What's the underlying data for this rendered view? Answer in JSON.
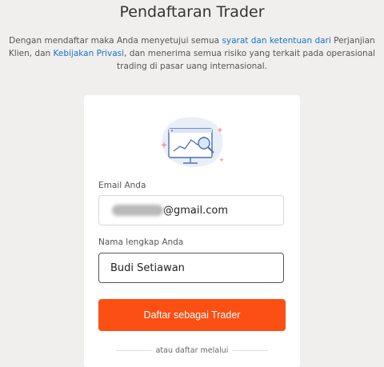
{
  "page": {
    "title": "Pendaftaran Trader",
    "intro": {
      "part1": "Dengan mendaftar maka Anda menyetujui semua ",
      "link_terms": "syarat dan ketentuan dari",
      "part2": " Perjanjian Klien, dan ",
      "link_privacy": "Kebijakan Privasi",
      "part3": ", dan menerima semua risiko yang terkait pada operasional trading di pasar uang internasional."
    }
  },
  "form": {
    "illustration_icon": "monitor-chart-magnifier-icon",
    "email_label": "Email Anda",
    "email_value_visible": "@gmail.com",
    "name_label": "Nama lengkap Anda",
    "name_value": "Budi Setiawan",
    "submit_label": "Daftar sebagai Trader",
    "alt_signup_label": "atau daftar melalui"
  },
  "colors": {
    "accent": "#fb4f14",
    "link": "#1a73c9",
    "background": "#f0efee"
  }
}
